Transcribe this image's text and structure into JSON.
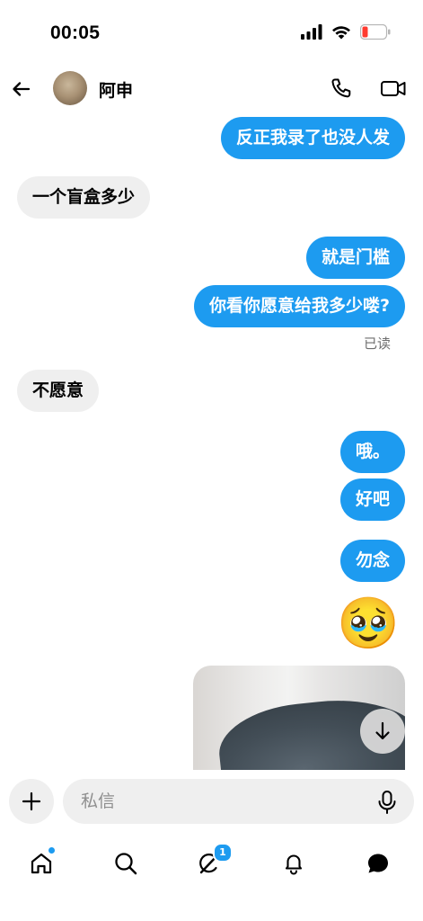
{
  "status_bar": {
    "time": "00:05",
    "icons": [
      "signal-icon",
      "wifi-icon",
      "battery-icon"
    ],
    "battery_color": "#ff3b30"
  },
  "header": {
    "contact_name": "阿申",
    "icons": [
      "back-arrow-icon",
      "phone-icon",
      "video-camera-icon"
    ]
  },
  "colors": {
    "outgoing_bubble": "#1d9bf0",
    "incoming_bubble": "#efefef",
    "accent": "#1d9bf0"
  },
  "messages": [
    {
      "direction": "out",
      "text": "反正我录了也没人发"
    },
    {
      "direction": "in",
      "text": "一个盲盒多少"
    },
    {
      "direction": "out",
      "text": "就是门槛"
    },
    {
      "direction": "out",
      "text": "你看你愿意给我多少喽?"
    },
    {
      "direction": "status",
      "text": "已读"
    },
    {
      "direction": "in",
      "text": "不愿意"
    },
    {
      "direction": "out",
      "text": "哦。"
    },
    {
      "direction": "out",
      "text": "好吧"
    },
    {
      "direction": "out",
      "text": "勿念"
    },
    {
      "direction": "out",
      "text": "🥹"
    }
  ],
  "composer": {
    "placeholder": "私信",
    "icons": [
      "plus-icon",
      "microphone-icon"
    ]
  },
  "bottom_nav": {
    "items": [
      "home-icon",
      "search-icon",
      "grok-icon",
      "bell-icon",
      "messages-icon"
    ],
    "grok_badge_count": "1"
  }
}
